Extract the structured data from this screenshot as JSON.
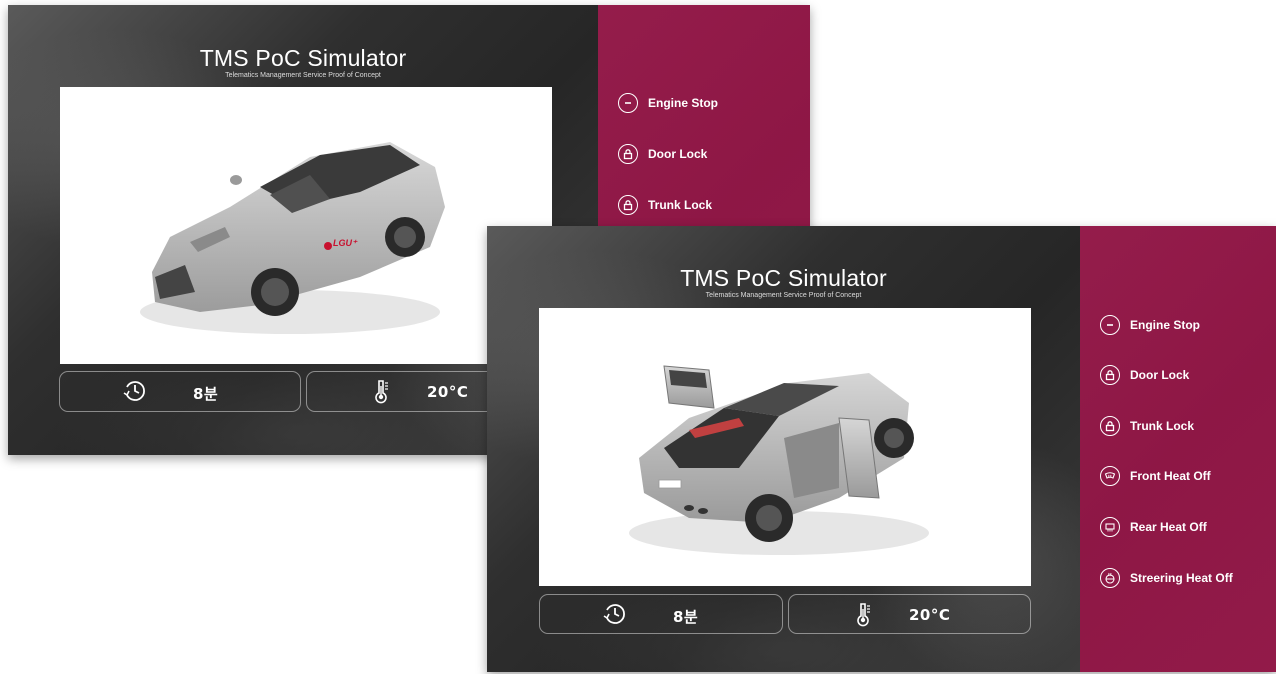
{
  "screens": [
    {
      "app_title": "TMS PoC Simulator",
      "app_subtitle": "Telematics Management Service Proof of Concept",
      "car_brand": "LGU⁺",
      "timer_icon": "timer-icon",
      "timer_value": "8분",
      "temperature_icon": "thermometer-icon",
      "temperature_value": "20°C",
      "menu": [
        {
          "label": "Engine Stop",
          "icon": "engine-stop-icon"
        },
        {
          "label": "Door Lock",
          "icon": "lock-icon"
        },
        {
          "label": "Trunk Lock",
          "icon": "lock-icon"
        }
      ]
    },
    {
      "app_title": "TMS PoC Simulator",
      "app_subtitle": "Telematics Management Service Proof of Concept",
      "timer_icon": "timer-icon",
      "timer_value": "8분",
      "temperature_icon": "thermometer-icon",
      "temperature_value": "20°C",
      "menu": [
        {
          "label": "Engine Stop",
          "icon": "engine-stop-icon"
        },
        {
          "label": "Door Lock",
          "icon": "lock-icon"
        },
        {
          "label": "Trunk Lock",
          "icon": "lock-icon"
        },
        {
          "label": "Front Heat Off",
          "icon": "front-defrost-icon"
        },
        {
          "label": "Rear Heat Off",
          "icon": "rear-defrost-icon"
        },
        {
          "label": "Streering Heat Off",
          "icon": "steering-heat-icon"
        }
      ]
    }
  ],
  "colors": {
    "sidebar_accent": "#9b1046",
    "panel_background": "#ffffff",
    "car_body": "#bdbdbd"
  }
}
